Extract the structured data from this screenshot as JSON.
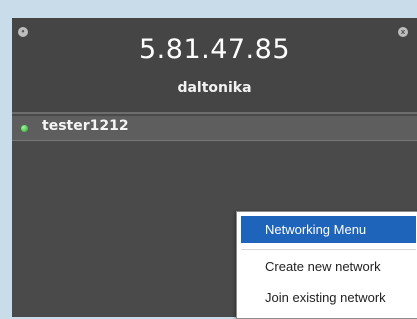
{
  "window": {
    "ip_address": "5.81.47.85",
    "network_name": "daltonika",
    "close_glyph": "x",
    "menu_glyph": "•"
  },
  "members": [
    {
      "name": "tester1212",
      "status": "online",
      "status_color": "#2ecc40"
    }
  ],
  "context_menu": {
    "title": "Networking Menu",
    "items": [
      {
        "label": "Create new network"
      },
      {
        "label": "Join existing network"
      }
    ]
  },
  "colors": {
    "window_bg": "#4a4a4a",
    "member_row_bg": "#5e5e5e",
    "menu_highlight": "#1f64bb",
    "desktop_bg": "#c9dcea"
  },
  "icons": {
    "left_corner": "window-menu-icon",
    "right_corner": "close-icon",
    "member_status": "online-status-icon"
  }
}
